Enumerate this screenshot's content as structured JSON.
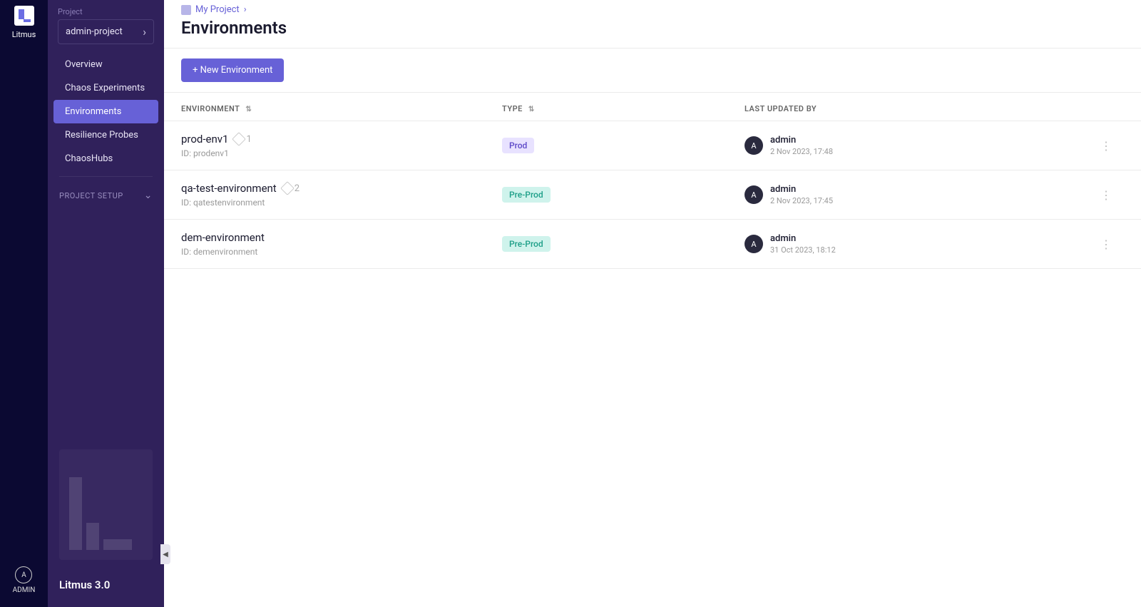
{
  "rail": {
    "brand": "Litmus",
    "user_label": "ADMIN",
    "user_initial": "A"
  },
  "sidebar": {
    "project_label": "Project",
    "project_selected": "admin-project",
    "nav": [
      {
        "label": "Overview"
      },
      {
        "label": "Chaos Experiments"
      },
      {
        "label": "Environments"
      },
      {
        "label": "Resilience Probes"
      },
      {
        "label": "ChaosHubs"
      }
    ],
    "section_setup": "PROJECT SETUP",
    "version": "Litmus 3.0"
  },
  "breadcrumb": "My Project",
  "page_title": "Environments",
  "toolbar": {
    "new_env": "+ New Environment"
  },
  "columns": {
    "env": "ENVIRONMENT",
    "type": "TYPE",
    "updated": "LAST UPDATED BY"
  },
  "rows": [
    {
      "name": "prod-env1",
      "tags": "1",
      "id_prefix": "ID: ",
      "id": "prodenv1",
      "type": "Prod",
      "type_class": "prod",
      "user_initial": "A",
      "user": "admin",
      "date": "2 Nov 2023, 17:48"
    },
    {
      "name": "qa-test-environment",
      "tags": "2",
      "id_prefix": "ID: ",
      "id": "qatestenvironment",
      "type": "Pre-Prod",
      "type_class": "preprod",
      "user_initial": "A",
      "user": "admin",
      "date": "2 Nov 2023, 17:45"
    },
    {
      "name": "dem-environment",
      "tags": "",
      "id_prefix": "ID: ",
      "id": "demenvironment",
      "type": "Pre-Prod",
      "type_class": "preprod",
      "user_initial": "A",
      "user": "admin",
      "date": "31 Oct 2023, 18:12"
    }
  ]
}
